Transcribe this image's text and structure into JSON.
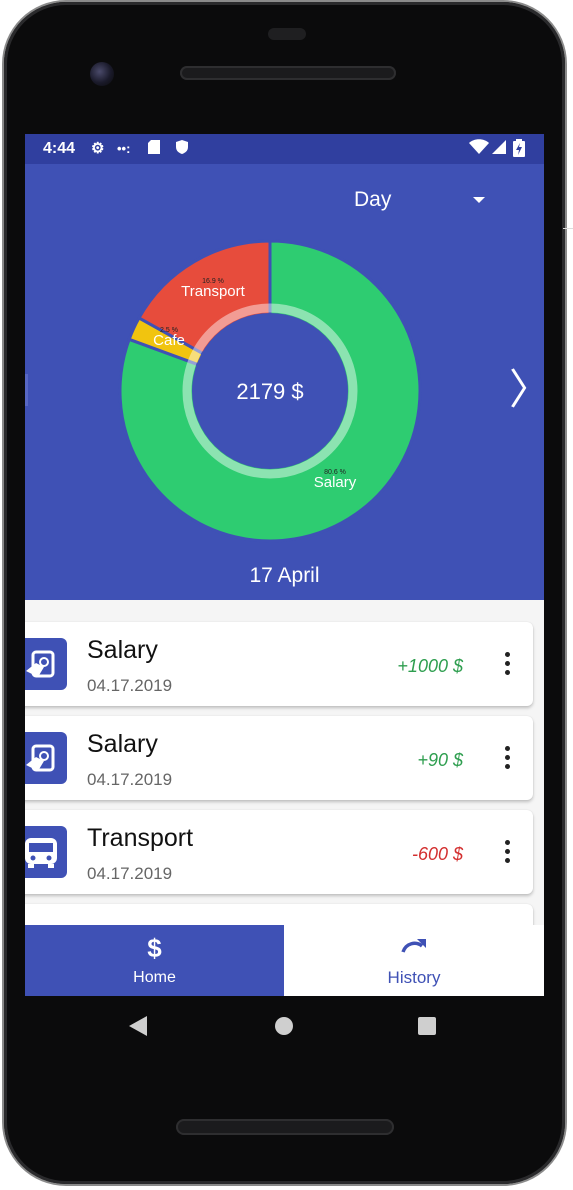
{
  "status_bar": {
    "time": "4:44"
  },
  "header": {
    "period_selector": "Day",
    "total": "2179 $",
    "date": "17 April"
  },
  "chart_data": {
    "type": "pie",
    "categories": [
      "Salary",
      "Cafe",
      "Transport"
    ],
    "values": [
      80.6,
      2.5,
      16.9
    ],
    "value_labels": [
      "80.6 %",
      "2.5 %",
      "16.9 %"
    ],
    "colors": [
      "#2ecc71",
      "#f1c40f",
      "#e74c3c"
    ],
    "center_text": "2179 $"
  },
  "transactions": [
    {
      "title": "Salary",
      "date": "04.17.2019",
      "amount": "+1000 $",
      "color": "#2e9e4f",
      "icon": "salary-icon"
    },
    {
      "title": "Salary",
      "date": "04.17.2019",
      "amount": "+90 $",
      "color": "#2e9e4f",
      "icon": "salary-icon"
    },
    {
      "title": "Transport",
      "date": "04.17.2019",
      "amount": "-600 $",
      "color": "#d32f2f",
      "icon": "bus-icon"
    }
  ],
  "nav": {
    "home": "Home",
    "history": "History",
    "home_icon": "$"
  }
}
